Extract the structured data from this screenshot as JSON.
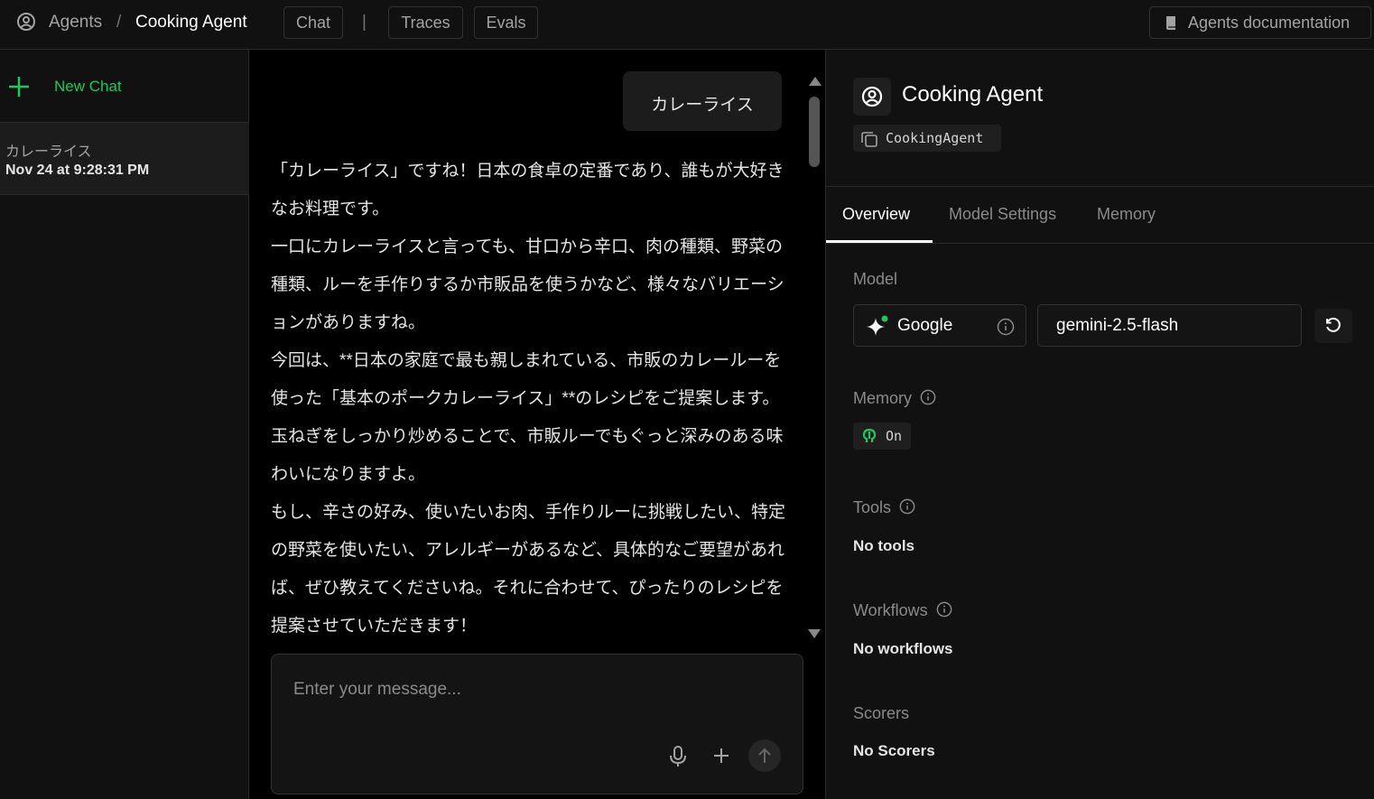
{
  "topbar": {
    "agents_label": "Agents",
    "separator": "/",
    "current_agent": "Cooking Agent",
    "tabs": [
      {
        "label": "Chat"
      },
      {
        "label": "Traces"
      },
      {
        "label": "Evals"
      }
    ],
    "pipe": "|",
    "docs_label": "Agents documentation"
  },
  "sidebar": {
    "new_chat_label": "New Chat",
    "chats": [
      {
        "title": "カレーライス",
        "date": "Nov 24 at 9:28:31 PM"
      }
    ]
  },
  "chat": {
    "user_message": "カレーライス",
    "assistant_paragraphs": [
      "「カレーライス」ですね！日本の食卓の定番であり、誰もが大好きなお料理です。",
      "一口にカレーライスと言っても、甘口から辛口、肉の種類、野菜の種類、ルーを手作りするか市販品を使うかなど、様々なバリエーションがありますね。",
      "今回は、**日本の家庭で最も親しまれている、市販のカレールーを使った「基本のポークカレーライス」**のレシピをご提案します。玉ねぎをしっかり炒めることで、市販ルーでもぐっと深みのある味わいになりますよ。",
      "もし、辛さの好み、使いたいお肉、手作りルーに挑戦したい、特定の野菜を使いたい、アレルギーがあるなど、具体的なご要望があれば、ぜひ教えてくださいね。それに合わせて、ぴったりのレシピを提案させていただきます！"
    ],
    "input_placeholder": "Enter your message..."
  },
  "panel": {
    "agent_name": "Cooking Agent",
    "agent_id": "CookingAgent",
    "tabs": [
      {
        "label": "Overview"
      },
      {
        "label": "Model Settings"
      },
      {
        "label": "Memory"
      }
    ],
    "model_label": "Model",
    "provider": "Google",
    "model_name": "gemini-2.5-flash",
    "memory_label": "Memory",
    "memory_state": "On",
    "tools_label": "Tools",
    "tools_value": "No tools",
    "workflows_label": "Workflows",
    "workflows_value": "No workflows",
    "scorers_label": "Scorers",
    "scorers_value": "No Scorers"
  },
  "colors": {
    "accent_green": "#22c55e",
    "background": "#000000",
    "panel": "#111111"
  }
}
